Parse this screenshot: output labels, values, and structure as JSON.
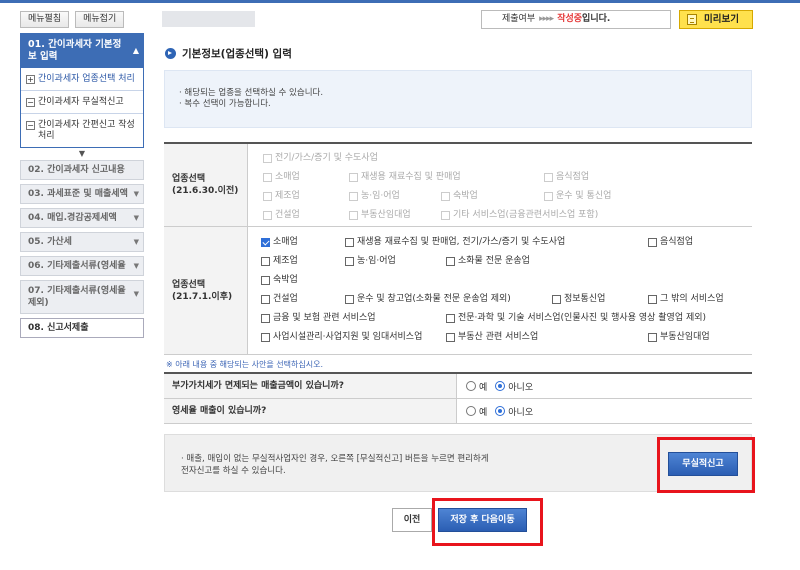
{
  "sidebar": {
    "expand_label": "메뉴펼침",
    "collapse_label": "메뉴접기",
    "active": {
      "label": "01. 간이과세자 기본정보 입력"
    },
    "subs": [
      {
        "label": "간이과세자 업종선택 처리",
        "icon": "plus-box-icon"
      },
      {
        "label": "간이과세자 무실적신고",
        "icon": "minus-box-icon"
      },
      {
        "label": "간이과세자 간편신고 작성 처리",
        "icon": "minus-box-icon"
      }
    ],
    "items": [
      {
        "label": "02. 간이과세자 신고내용"
      },
      {
        "label": "03. 과세표준 및 매출세액"
      },
      {
        "label": "04. 매입.경감공제세액"
      },
      {
        "label": "05. 가산세"
      },
      {
        "label": "06. 기타제출서류(영세율"
      },
      {
        "label": "07. 기타제출서류(영세율 제외)"
      },
      {
        "label": "08. 신고서제출"
      }
    ]
  },
  "header": {
    "status_label": "제출여부",
    "status_arrows": "▸▸▸▸",
    "status_value": "작성중",
    "status_suffix": "입니다.",
    "preview_label": "미리보기"
  },
  "main": {
    "title": "기본정보(업종선택) 입력",
    "info_lines": [
      "· 해당되는 업종을 선택하실 수 있습니다.",
      "· 복수 선택이 가능합니다."
    ],
    "old": {
      "head1": "업종선택",
      "head2": "(21.6.30.이전)",
      "options": [
        "전기/가스/증기 및 수도사업",
        "소매업",
        "재생용 재료수집 및 판매업",
        "음식점업",
        "제조업",
        "농·임·어업",
        "숙박업",
        "운수 및 통신업",
        "건설업",
        "부동산임대업",
        "기타 서비스업(금융관련서비스업 포함)"
      ]
    },
    "new": {
      "head1": "업종선택",
      "head2": "(21.7.1.이후)",
      "options": [
        "소매업",
        "재생용 재료수집 및 판매업, 전기/가스/증기 및 수도사업",
        "음식점업",
        "제조업",
        "농·임·어업",
        "소화물 전문 운송업",
        "숙박업",
        "건설업",
        "운수 및 창고업(소화물 전문 운송업 제외)",
        "정보통신업",
        "그 밖의 서비스업",
        "금융 및 보험 관련 서비스업",
        "전문·과학 및 기술 서비스업(인물사진 및 행사용 영상 촬영업 제외)",
        "사업시설관리·사업지원 및 임대서비스업",
        "부동산 관련 서비스업",
        "부동산임대업"
      ]
    },
    "notice": "※ 아래 내용 중 해당되는 사안을 선택하십시오.",
    "questions": [
      {
        "label": "부가가치세가 면제되는 매출금액이 있습니까?",
        "yes": "예",
        "no": "아니오"
      },
      {
        "label": "영세율 매출이 있습니까?",
        "yes": "예",
        "no": "아니오"
      }
    ],
    "bottom_text1": "· 매출, 매입이 없는 무실적사업자인 경우, 오른쪽 [무실적신고] 버튼을 누르면 편리하게",
    "bottom_text2": "전자신고를 하실 수 있습니다.",
    "no_record_button": "무실적신고",
    "prev_button": "이전",
    "save_button": "저장 후 다음이동"
  }
}
